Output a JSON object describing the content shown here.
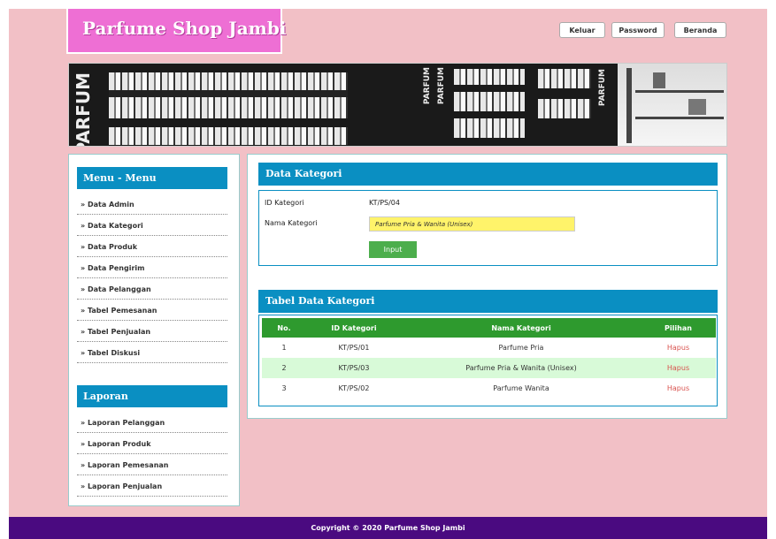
{
  "header": {
    "logo": "Parfume Shop Jambi",
    "buttons": [
      "Keluar",
      "Password",
      "Beranda"
    ]
  },
  "banner": {
    "words": [
      "PARFUM",
      "PARFUM",
      "PARFUM",
      "PARFUM"
    ]
  },
  "sidebar": {
    "menu_title": "Menu - Menu",
    "menu_items": [
      "» Data Admin",
      "» Data Kategori",
      "» Data Produk",
      "» Data Pengirim",
      "» Data Pelanggan",
      "» Tabel Pemesanan",
      "» Tabel Penjualan",
      "» Tabel Diskusi"
    ],
    "report_title": "Laporan",
    "report_items": [
      "» Laporan Pelanggan",
      "» Laporan Produk",
      "» Laporan Pemesanan",
      "» Laporan Penjualan"
    ]
  },
  "form": {
    "title": "Data Kategori",
    "id_label": "ID Kategori",
    "id_value": "KT/PS/04",
    "name_label": "Nama Kategori",
    "name_value": "Parfume Pria & Wanita (Unisex)",
    "submit_label": "Input"
  },
  "table": {
    "title": "Tabel Data Kategori",
    "headers": [
      "No.",
      "ID Kategori",
      "Nama Kategori",
      "Pilihan"
    ],
    "rows": [
      [
        "1",
        "KT/PS/01",
        "Parfume Pria",
        "Hapus"
      ],
      [
        "2",
        "KT/PS/03",
        "Parfume Pria & Wanita (Unisex)",
        "Hapus"
      ],
      [
        "3",
        "KT/PS/02",
        "Parfume Wanita",
        "Hapus"
      ]
    ]
  },
  "footer": {
    "text": "Copyright © 2020 Parfume Shop Jambi"
  }
}
